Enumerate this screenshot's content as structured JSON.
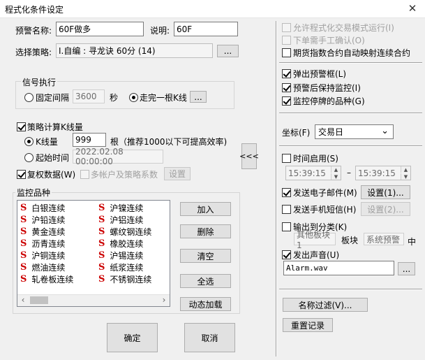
{
  "window": {
    "title": "程式化条件设定",
    "close_glyph": "✕"
  },
  "alert_name": {
    "label": "预警名称:",
    "value": "60F做多"
  },
  "description": {
    "label": "说明:",
    "value": "60F"
  },
  "strategy": {
    "label": "选择策略:",
    "value": "I.自编 : 寻龙诀 60分 (14)",
    "browse": "..."
  },
  "signal": {
    "group_title": "信号执行",
    "fixed_interval": "固定间隔",
    "interval_value": "3600",
    "seconds": "秒",
    "after_bar": "走完一根K线",
    "more": "..."
  },
  "calc": {
    "label": "策略计算K线量",
    "kbars_label": "K线量",
    "kbars_value": "999",
    "kbars_hint": "根（推荐1000以下可提高效率)",
    "start_label": "起始时间",
    "start_value": "2022.02.08 00:00:00",
    "adjust_label": "复权数据(W)",
    "multi_account": "多帐户及策略系数",
    "settings_btn": "设置"
  },
  "monitor": {
    "group_title": "监控品种",
    "items_left": [
      "白银连续",
      "沪铅连续",
      "黄金连续",
      "沥青连续",
      "沪铜连续",
      "燃油连续",
      "轧卷板连续"
    ],
    "items_right": [
      "沪镍连续",
      "沪铝连续",
      "螺纹钢连续",
      "橡胶连续",
      "沪锡连续",
      "纸浆连续",
      "不锈钢连续"
    ],
    "s_mark": "S",
    "scroll_left": "‹",
    "scroll_right": "›",
    "add": "加入",
    "delete": "删除",
    "clear": "清空",
    "select_all": "全选",
    "dynamic_load": "动态加载"
  },
  "collapse_btn": "<<<",
  "ok": "确定",
  "cancel": "取消",
  "right": {
    "allow_auto": "允许程式化交易模式运行(I)",
    "manual_confirm": "下单需手工确认(O)",
    "futures_index_map": "期货指数合约自动映射连续合约",
    "popup_alert": "弹出预警框(L)",
    "keep_monitor": "预警后保持监控(I)",
    "monitor_suspended": "监控停牌的品种(G)",
    "coord_label": "坐标(F)",
    "coord_value": "交易日",
    "coord_arrow": "⌄",
    "time_enable": "时间启用(S)",
    "time_from": "15:39:15",
    "time_to": "15:39:15",
    "time_dash": "–",
    "spin_up": "▲",
    "spin_down": "▼",
    "send_email": "发送电子邮件(M)",
    "email_settings": "设置(1)...",
    "send_sms": "发送手机短信(H)",
    "sms_settings": "设置(2)...",
    "output_category": "输出到分类(K)",
    "other_block": "其他板块1",
    "block_word": "板块",
    "system_alert": "系统预警",
    "middle_word": "中",
    "play_sound": "发出声音(U)",
    "sound_file": "Alarm.wav",
    "sound_browse": "...",
    "name_filter": "名称过滤(V)...",
    "reset_log": "重置记录"
  }
}
